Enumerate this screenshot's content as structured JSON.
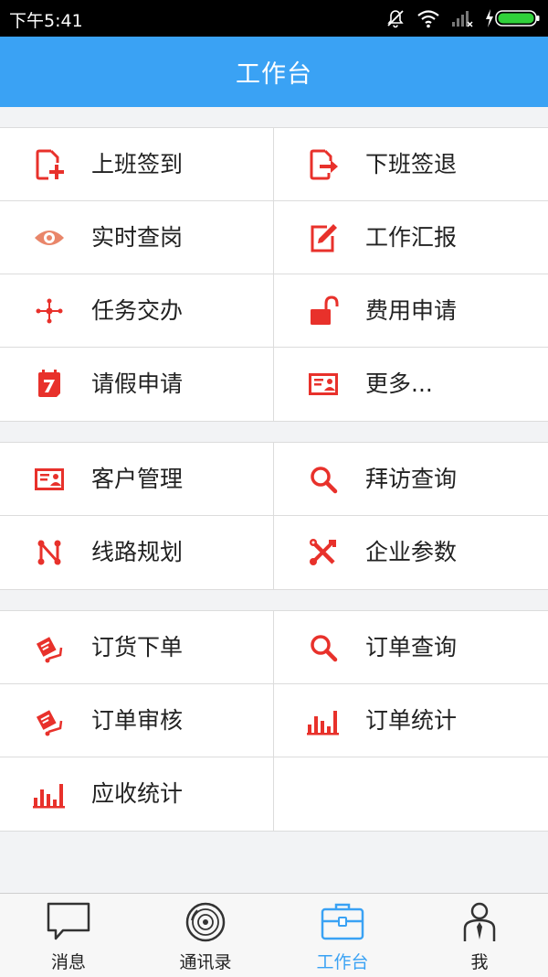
{
  "status_bar": {
    "time": "下午5:41"
  },
  "nav": {
    "title": "工作台"
  },
  "sections": [
    [
      [
        {
          "label": "上班签到",
          "icon": "clock-in-icon"
        },
        {
          "label": "下班签退",
          "icon": "clock-out-icon"
        }
      ],
      [
        {
          "label": "实时查岗",
          "icon": "eye-icon"
        },
        {
          "label": "工作汇报",
          "icon": "edit-report-icon"
        }
      ],
      [
        {
          "label": "任务交办",
          "icon": "task-network-icon"
        },
        {
          "label": "费用申请",
          "icon": "unlock-icon"
        }
      ],
      [
        {
          "label": "请假申请",
          "icon": "calendar-leave-icon"
        },
        {
          "label": "更多...",
          "icon": "id-card-icon"
        }
      ]
    ],
    [
      [
        {
          "label": "客户管理",
          "icon": "customer-card-icon"
        },
        {
          "label": "拜访查询",
          "icon": "search-icon"
        }
      ],
      [
        {
          "label": "线路规划",
          "icon": "route-icon"
        },
        {
          "label": "企业参数",
          "icon": "tools-icon"
        }
      ]
    ],
    [
      [
        {
          "label": "订货下单",
          "icon": "order-cart-icon"
        },
        {
          "label": "订单查询",
          "icon": "search-icon"
        }
      ],
      [
        {
          "label": "订单审核",
          "icon": "order-cart-icon"
        },
        {
          "label": "订单统计",
          "icon": "bar-chart-icon"
        }
      ],
      [
        {
          "label": "应收统计",
          "icon": "bar-chart-icon"
        },
        null
      ]
    ]
  ],
  "tabs": [
    {
      "label": "消息",
      "icon": "message-bubble-icon",
      "active": false
    },
    {
      "label": "通讯录",
      "icon": "contacts-disc-icon",
      "active": false
    },
    {
      "label": "工作台",
      "icon": "briefcase-icon",
      "active": true
    },
    {
      "label": "我",
      "icon": "user-profile-icon",
      "active": false
    }
  ],
  "colors": {
    "accent": "#3aa2f4",
    "icon_red": "#e8312b",
    "eye_orange": "#e9866a"
  }
}
